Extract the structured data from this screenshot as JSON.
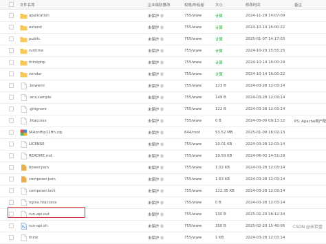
{
  "header": {
    "name": "文件名称",
    "protect": "企业级防篡改",
    "perm": "权限/所有者",
    "size": "大小",
    "time": "修改时间",
    "note": "备注"
  },
  "rows": [
    {
      "icon": "folder-icon",
      "name": "application",
      "protect": "未保护",
      "perm": "755/www",
      "size": "计算",
      "calc": true,
      "time": "2024-11-29 14:07:09",
      "note": ""
    },
    {
      "icon": "folder-icon",
      "name": "extend",
      "protect": "未保护",
      "perm": "755/www",
      "size": "计算",
      "calc": true,
      "time": "2024-10-14 16:00:22",
      "note": ""
    },
    {
      "icon": "folder-icon",
      "name": "public",
      "protect": "未保护",
      "perm": "755/www",
      "size": "计算",
      "calc": true,
      "time": "2025-01-07 14:17:03",
      "note": ""
    },
    {
      "icon": "folder-icon",
      "name": "runtime",
      "protect": "未保护",
      "perm": "755/www",
      "size": "计算",
      "calc": true,
      "time": "2024-10-29 15:55:25",
      "note": ""
    },
    {
      "icon": "folder-icon",
      "name": "thinkphp",
      "protect": "未保护",
      "perm": "755/www",
      "size": "计算",
      "calc": true,
      "time": "2024-10-14 16:00:29",
      "note": ""
    },
    {
      "icon": "folder-icon",
      "name": "vendor",
      "protect": "未保护",
      "perm": "755/www",
      "size": "计算",
      "calc": true,
      "time": "2024-10-14 16:00:22",
      "note": ""
    },
    {
      "icon": "file-icon",
      "name": ".bowerrc",
      "protect": "未保护",
      "perm": "755/www",
      "size": "123 B",
      "calc": false,
      "time": "2024-03-28 12:03:14",
      "note": ""
    },
    {
      "icon": "file-icon",
      "name": ".env.sample",
      "protect": "未保护",
      "perm": "755/www",
      "size": "149 B",
      "calc": false,
      "time": "2024-03-28 12:03:14",
      "note": ""
    },
    {
      "icon": "file-icon",
      "name": ".gitignore",
      "protect": "未保护",
      "perm": "755/www",
      "size": "122 B",
      "calc": false,
      "time": "2024-03-28 12:03:14",
      "note": ""
    },
    {
      "icon": "file-icon",
      "name": ".htaccess",
      "protect": "未保护",
      "perm": "755/www",
      "size": "0 B",
      "calc": false,
      "time": "2024-05-09 09:13:12",
      "note": "PS: Apache用户配"
    },
    {
      "icon": "zip-icon",
      "name": "fAAznHip11Hh.zip",
      "protect": "未保护",
      "perm": "644/root",
      "size": "53.52 MB",
      "calc": false,
      "time": "2025-01-09 16:02:13",
      "note": ""
    },
    {
      "icon": "file-icon",
      "name": "LICENSE",
      "protect": "未保护",
      "perm": "755/www",
      "size": "10.01 KB",
      "calc": false,
      "time": "2024-03-28 12:03:14",
      "note": ""
    },
    {
      "icon": "file-icon",
      "name": "README.md",
      "protect": "未保护",
      "perm": "755/www",
      "size": "19.59 KB",
      "calc": false,
      "time": "2024-06-03 14:51:29",
      "note": ""
    },
    {
      "icon": "json-icon",
      "name": "bower.json",
      "protect": "未保护",
      "perm": "755/www",
      "size": "1.02 KB",
      "calc": false,
      "time": "2024-03-28 12:03:14",
      "note": ""
    },
    {
      "icon": "json-icon",
      "name": "composer.json",
      "protect": "未保护",
      "perm": "755/www",
      "size": "1.63 KB",
      "calc": false,
      "time": "2024-03-28 12:03:14",
      "note": ""
    },
    {
      "icon": "file-icon",
      "name": "composer.lock",
      "protect": "未保护",
      "perm": "755/www",
      "size": "122.35 KB",
      "calc": false,
      "time": "2024-03-28 12:03:14",
      "note": ""
    },
    {
      "icon": "file-icon",
      "name": "nginx.htaccess",
      "protect": "未保护",
      "perm": "755/www",
      "size": "0 B",
      "calc": false,
      "time": "2024-03-28 12:03:14",
      "note": ""
    },
    {
      "icon": "file-icon",
      "name": "run-api.out",
      "protect": "未保护",
      "perm": "755/www",
      "size": "100 B",
      "calc": false,
      "time": "2025-02-20 16:12:34",
      "note": ""
    },
    {
      "icon": "sh-icon",
      "name": "run-api.sh",
      "protect": "未保护",
      "perm": "755/www",
      "size": "350 B",
      "calc": false,
      "time": "2025-02-20 15:40:06",
      "note": ""
    },
    {
      "icon": "file-icon",
      "name": "think",
      "protect": "未保护",
      "perm": "755/www",
      "size": "1 KB",
      "calc": false,
      "time": "2024-03-28 12:03:14",
      "note": ""
    }
  ],
  "watermark": "CSDN @宋拾壹",
  "colors": {
    "accent_green": "#20a53a",
    "highlight_red": "#d7262b",
    "folder": "#f5b93c"
  }
}
